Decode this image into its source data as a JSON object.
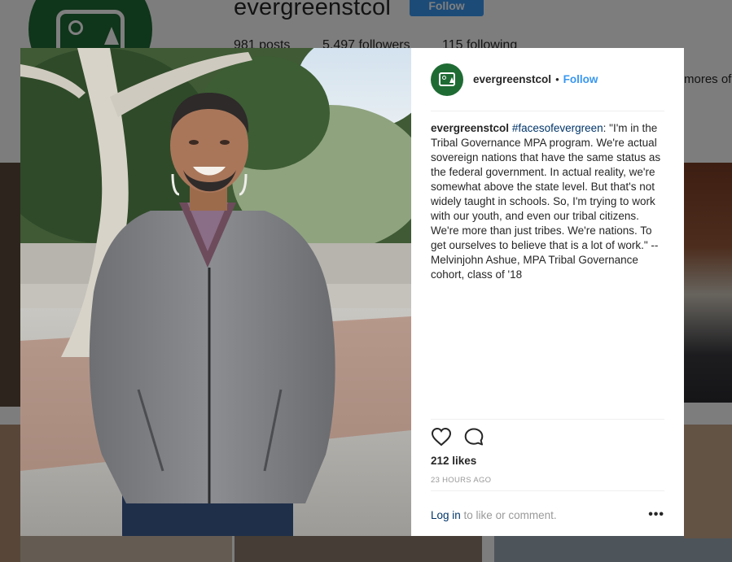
{
  "profile": {
    "username": "evergreenstcol",
    "follow_label": "Follow",
    "stats": {
      "posts": "981 posts",
      "followers": "5,497 followers",
      "following": "115 following"
    },
    "bio_fragment": "mores of"
  },
  "post": {
    "username": "evergreenstcol",
    "separator": "•",
    "follow_label": "Follow",
    "caption": {
      "username": "evergreenstcol",
      "hashtag": "#facesofevergreen",
      "text": ": \"I'm in the Tribal Governance MPA program. We're actual sovereign nations that have the same status as the federal government. In actual reality, we're somewhat above the state level. But that's not widely taught in schools. So, I'm trying to work with our youth, and even our tribal citizens. We're more than just tribes. We're nations. To get ourselves to believe that is a lot of work.\" -- Melvinjohn Ashue, MPA Tribal Governance cohort, class of '18"
    },
    "likes": "212 likes",
    "timestamp": "23 HOURS AGO",
    "footer": {
      "login_label": "Log in",
      "login_suffix": " to like or comment.",
      "more_icon": "•••"
    },
    "icons": {
      "like": "heart-icon",
      "comment": "comment-bubble-icon",
      "more": "more-options-icon"
    }
  },
  "colors": {
    "brand_green": "#1f6b34",
    "link_blue": "#3897f0",
    "hashtag_blue": "#003569",
    "muted_gray": "#999999"
  }
}
